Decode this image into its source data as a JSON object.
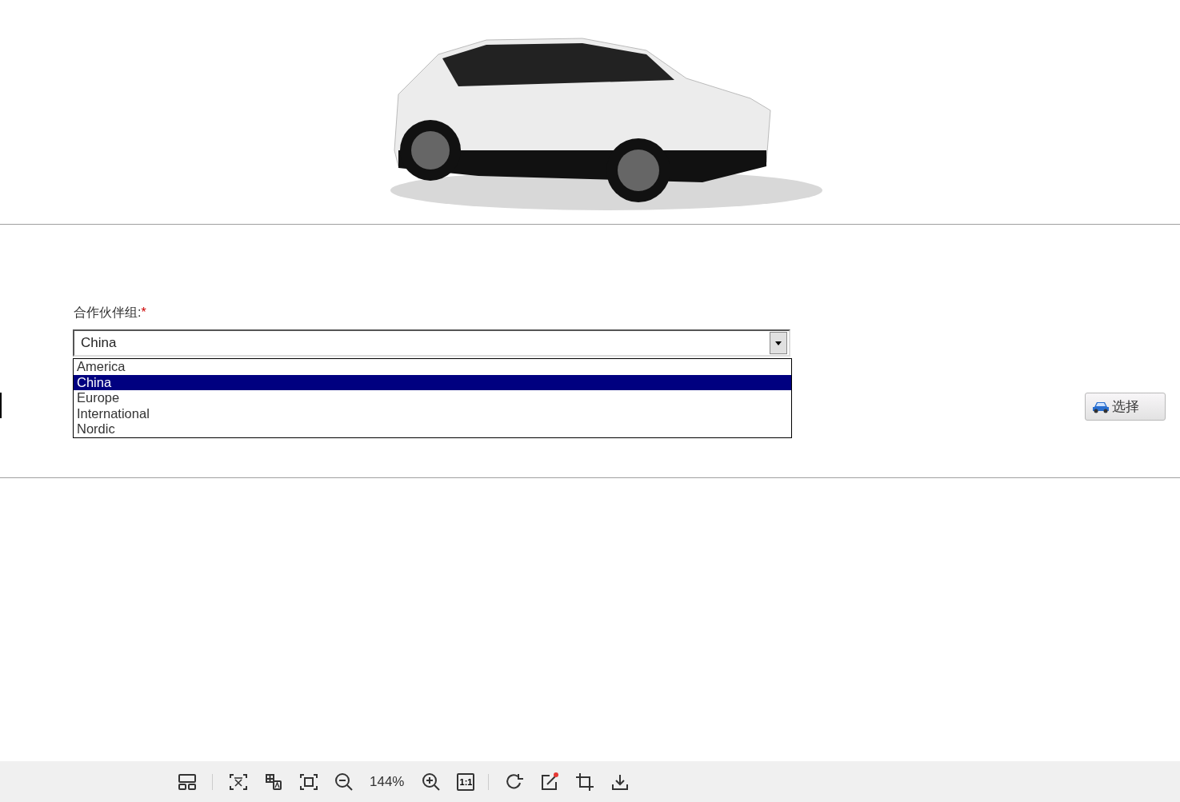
{
  "form": {
    "label": "合作伙伴组:",
    "required_mark": "*",
    "select": {
      "value": "China",
      "expanded": true,
      "options": [
        {
          "label": "America",
          "selected": false
        },
        {
          "label": "China",
          "selected": true
        },
        {
          "label": "Europe",
          "selected": false
        },
        {
          "label": "International",
          "selected": false
        },
        {
          "label": "Nordic",
          "selected": false
        }
      ]
    },
    "choose_button": {
      "label": "选择"
    }
  },
  "viewer_toolbar": [
    {
      "kind": "layout"
    },
    {
      "kind": "separator"
    },
    {
      "kind": "text-extract"
    },
    {
      "kind": "translate"
    },
    {
      "kind": "fit"
    },
    {
      "kind": "zoom-out"
    },
    {
      "kind": "zoom-level",
      "text": "144%"
    },
    {
      "kind": "zoom-in"
    },
    {
      "kind": "actual-size",
      "text": "1:1"
    },
    {
      "kind": "separator"
    },
    {
      "kind": "rotate"
    },
    {
      "kind": "edit",
      "badge": true
    },
    {
      "kind": "crop"
    },
    {
      "kind": "download"
    }
  ]
}
